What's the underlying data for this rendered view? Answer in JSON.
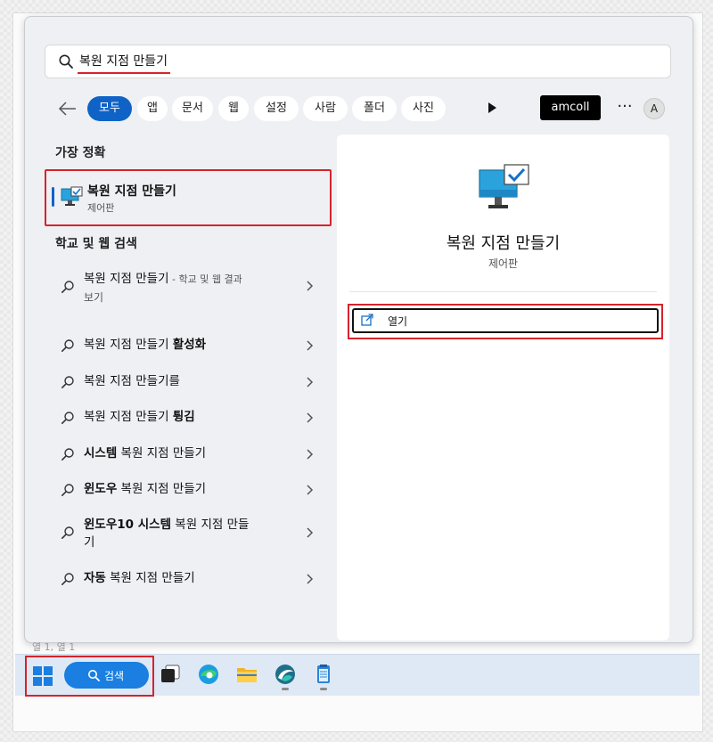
{
  "search": {
    "query": "복원 지점 만들기"
  },
  "filters": {
    "items": [
      {
        "label": "모두",
        "active": true
      },
      {
        "label": "앱"
      },
      {
        "label": "문서"
      },
      {
        "label": "웹"
      },
      {
        "label": "설정"
      },
      {
        "label": "사람"
      },
      {
        "label": "폴더"
      },
      {
        "label": "사진"
      }
    ],
    "account": "amcoll",
    "more": "···",
    "avatar_letter": "A"
  },
  "best_match": {
    "heading": "가장 정확",
    "title": "복원 지점 만들기",
    "subtitle": "제어판"
  },
  "web_results": {
    "heading": "학교 및 웹 검색",
    "items": [
      {
        "pre": "복원 지점 만들기",
        "bold": "",
        "post": "",
        "suffix": " - 학교 및 웹 결과",
        "line2": "보기"
      },
      {
        "pre": "복원 지점 만들기 ",
        "bold": "활성화",
        "post": ""
      },
      {
        "pre": "복원 지점 만들기를",
        "bold": "",
        "post": ""
      },
      {
        "pre": "복원 지점 만들기 ",
        "bold": "튕김",
        "post": ""
      },
      {
        "pre": "",
        "bold": "시스템",
        "post": " 복원 지점 만들기"
      },
      {
        "pre": "",
        "bold": "윈도우",
        "post": " 복원 지점 만들기"
      },
      {
        "pre": "",
        "bold": "윈도우10 시스템",
        "post": " 복원 지점 만들",
        "line2": "기"
      },
      {
        "pre": "",
        "bold": "자동",
        "post": " 복원 지점 만들기"
      }
    ]
  },
  "preview": {
    "title": "복원 지점 만들기",
    "subtitle": "제어판",
    "open_label": "열기"
  },
  "behind_text": "열 1, 열 1",
  "taskbar": {
    "search_label": "검색",
    "icons": [
      "task-view-icon",
      "edge-icon",
      "file-explorer-icon",
      "browser-icon",
      "notepad-icon"
    ]
  },
  "colors": {
    "accent": "#0f63c7",
    "highlight": "#d6232a",
    "taskbar": "#dfe9f6"
  }
}
